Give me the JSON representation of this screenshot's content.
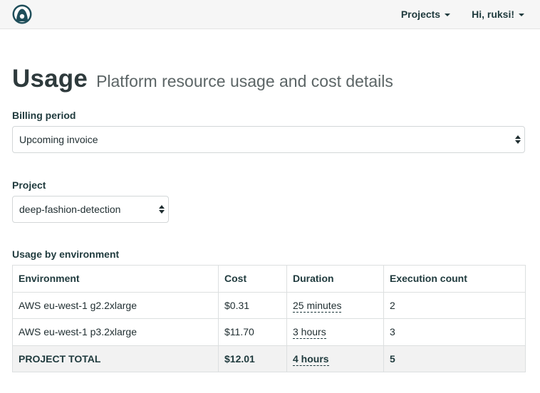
{
  "nav": {
    "projects_label": "Projects",
    "user_label": "Hi, ruksi!"
  },
  "page": {
    "title": "Usage",
    "subtitle": "Platform resource usage and cost details"
  },
  "billing": {
    "label": "Billing period",
    "selected": "Upcoming invoice"
  },
  "project": {
    "label": "Project",
    "selected": "deep-fashion-detection"
  },
  "usage": {
    "label": "Usage by environment",
    "headers": [
      "Environment",
      "Cost",
      "Duration",
      "Execution count"
    ],
    "rows": [
      {
        "environment": "AWS eu-west-1 g2.2xlarge",
        "cost": "$0.31",
        "duration": "25 minutes",
        "count": "2"
      },
      {
        "environment": "AWS eu-west-1 p3.2xlarge",
        "cost": "$11.70",
        "duration": "3 hours",
        "count": "3"
      }
    ],
    "total": {
      "label": "PROJECT TOTAL",
      "cost": "$12.01",
      "duration": "4 hours",
      "count": "5"
    }
  },
  "colors": {
    "brand": "#1f4e5a",
    "text": "#1f3a3d",
    "navbar_bg": "#f6f6f6",
    "total_row_bg": "#f2f2f2"
  },
  "icons": {
    "logo": "brand-logo-icon",
    "dropdown": "caret-down-icon",
    "select": "select-arrows-icon"
  }
}
